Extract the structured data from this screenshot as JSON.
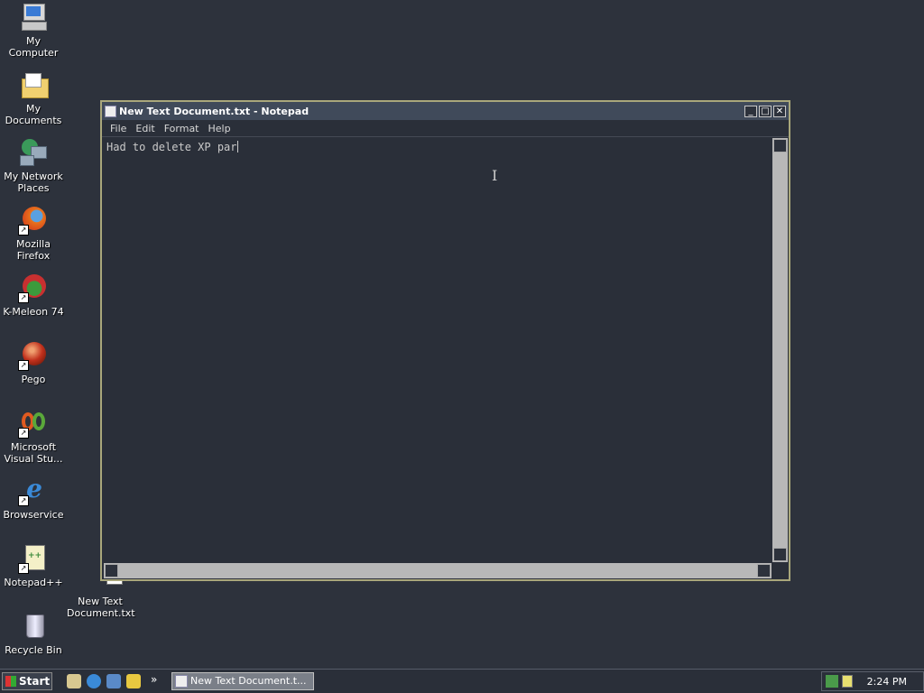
{
  "desktop": {
    "icons": [
      {
        "label": "My Computer",
        "icon": "computer-icon"
      },
      {
        "label": "My Documents",
        "icon": "folder-icon"
      },
      {
        "label": "My Network Places",
        "icon": "network-icon"
      },
      {
        "label": "Mozilla Firefox",
        "icon": "firefox-icon"
      },
      {
        "label": "K-Meleon 74",
        "icon": "kmeleon-icon"
      },
      {
        "label": "Pego",
        "icon": "pego-icon"
      },
      {
        "label": "Microsoft Visual Stu...",
        "icon": "visual-studio-icon"
      },
      {
        "label": "Browservice",
        "icon": "ie-icon"
      },
      {
        "label": "Notepad++",
        "icon": "notepadpp-icon"
      },
      {
        "label": "Recycle Bin",
        "icon": "recycle-bin-icon"
      },
      {
        "label": "New Text Document.txt",
        "icon": "text-file-icon"
      }
    ]
  },
  "window": {
    "title": "New Text Document.txt - Notepad",
    "buttons": {
      "minimize": "_",
      "maximize": "□",
      "close": "✕"
    },
    "menu": [
      "File",
      "Edit",
      "Format",
      "Help"
    ],
    "content": "Had to delete XP par"
  },
  "taskbar": {
    "start_label": "Start",
    "task_label": "New Text Document.t...",
    "overflow": "»",
    "clock": "2:24 PM"
  },
  "colors": {
    "desktop_bg": "#2d323c",
    "titlebar": "#404a5a",
    "window_border": "#a9a77b"
  }
}
